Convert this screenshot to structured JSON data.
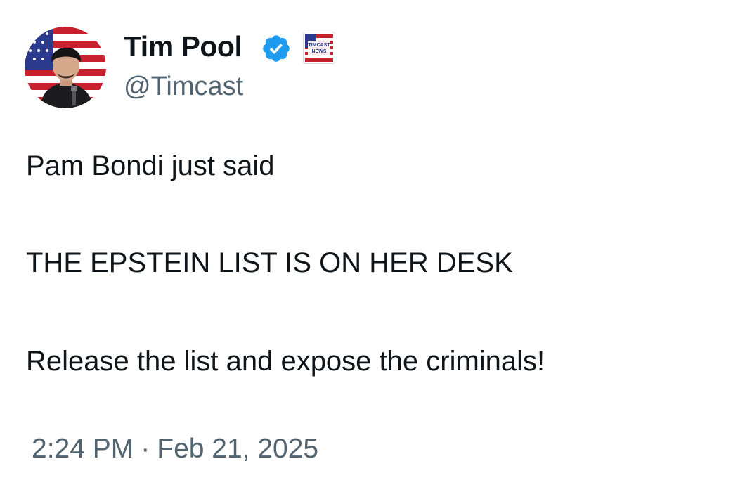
{
  "author": {
    "name": "Tim Pool",
    "handle": "@Timcast",
    "verified": true,
    "affiliate_badge_label": "TIMCAST NEWS",
    "avatar_icon": "avatar-flag-portrait"
  },
  "tweet": {
    "lines": [
      "Pam Bondi just said",
      "THE EPSTEIN LIST IS ON HER DESK",
      "Release the list and expose the criminals!"
    ]
  },
  "meta": {
    "time": "2:24 PM",
    "separator": "·",
    "date": "Feb 21, 2025"
  },
  "colors": {
    "text_primary": "#0f1419",
    "text_secondary": "#536471",
    "verified_blue": "#1d9bf0"
  }
}
